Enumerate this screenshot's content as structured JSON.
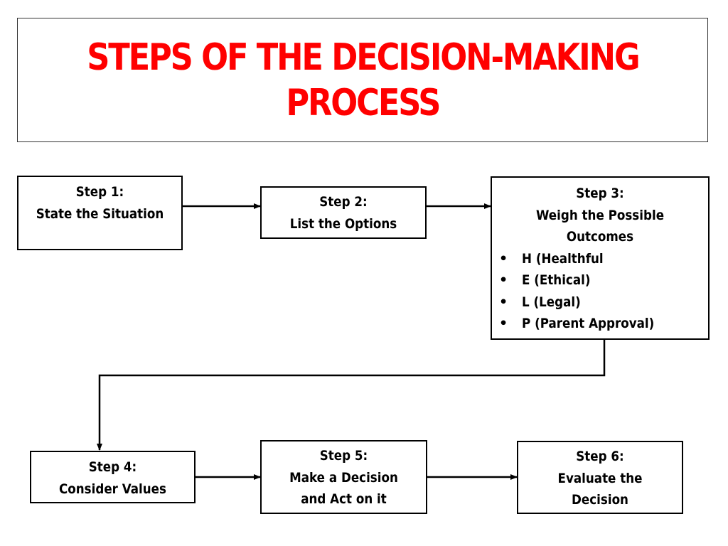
{
  "title": {
    "line1": "STEPS OF THE DECISION-MAKING",
    "line2": "PROCESS",
    "color": "#ff0000"
  },
  "steps": [
    {
      "label": "Step 1:",
      "text": [
        "State the Situation"
      ]
    },
    {
      "label": "Step 2:",
      "text": [
        "List the Options"
      ]
    },
    {
      "label": "Step 3:",
      "text": [
        "Weigh the Possible",
        "Outcomes"
      ],
      "bullets": [
        "H (Healthful",
        "E (Ethical)",
        "L (Legal)",
        "P (Parent Approval)"
      ]
    },
    {
      "label": "Step 4:",
      "text": [
        "Consider Values"
      ]
    },
    {
      "label": "Step 5:",
      "text": [
        "Make a Decision",
        "and Act on it"
      ]
    },
    {
      "label": "Step 6:",
      "text": [
        "Evaluate the",
        "Decision"
      ]
    }
  ],
  "bullet_glyph": "•"
}
